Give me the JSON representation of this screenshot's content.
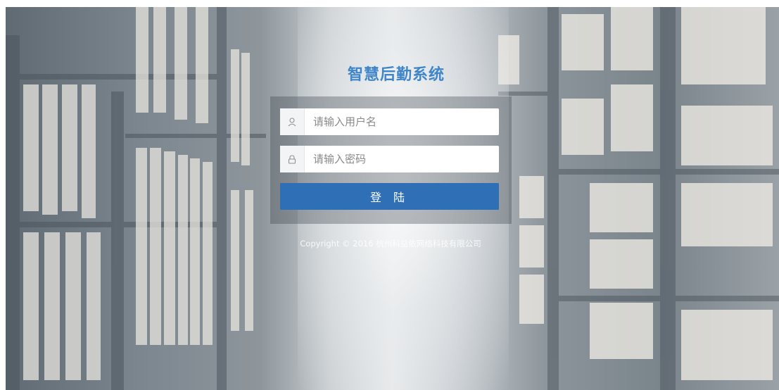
{
  "login": {
    "title": "智慧后勤系统",
    "username_placeholder": "请输入用户名",
    "password_placeholder": "请输入密码",
    "login_button_label": "登 陆",
    "username_icon": "user-icon",
    "password_icon": "lock-icon"
  },
  "footer": {
    "copyright": "Copyright © 2016 杭州科益依网络科技有限公司"
  },
  "colors": {
    "title_blue": "#3f86c9",
    "button_blue": "#2e6fb5"
  }
}
